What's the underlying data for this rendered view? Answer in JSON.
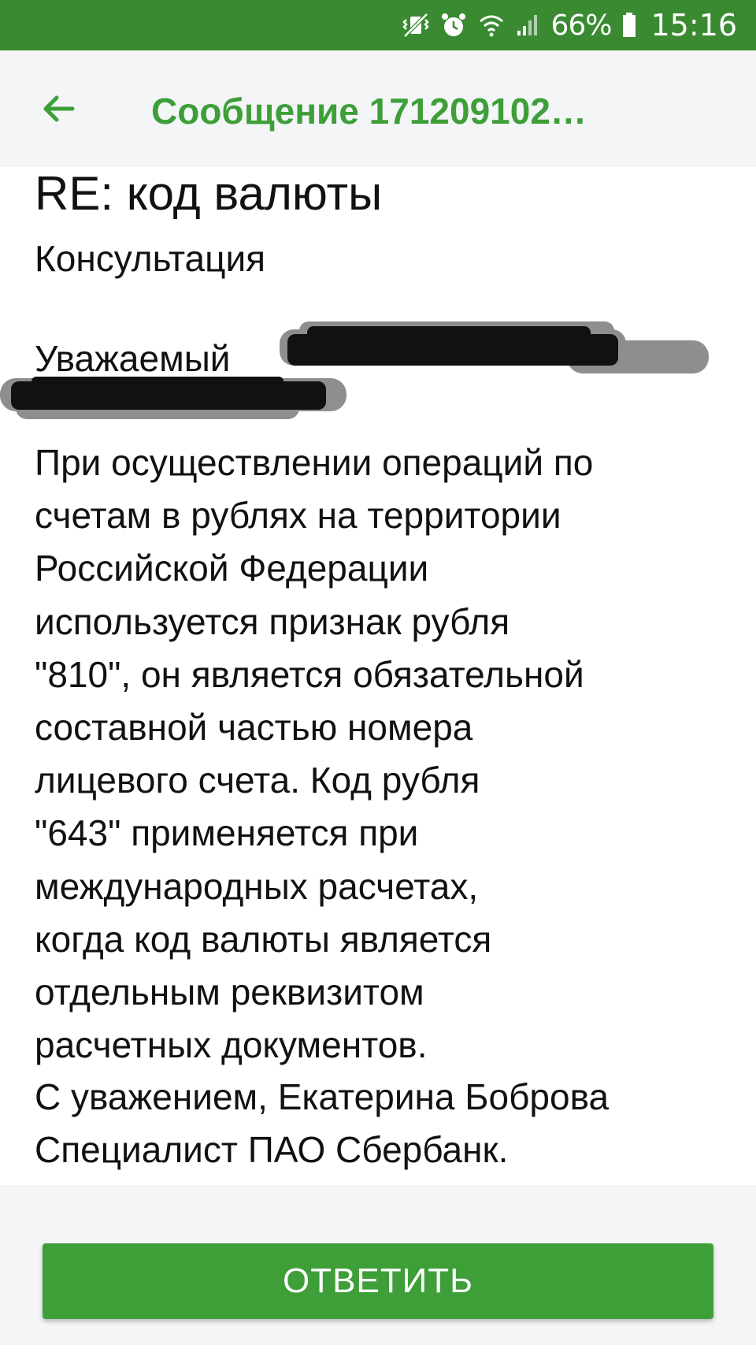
{
  "status_bar": {
    "battery": "66%",
    "time": "15:16"
  },
  "header": {
    "title": "Сообщение 171209102…"
  },
  "message": {
    "subject": "RE: код валюты",
    "category": "Консультация",
    "greeting": "Уважаемый",
    "body_lines": [
      "При осуществлении операций по",
      "счетам в рублях на территории",
      "Российской Федерации",
      "используется признак рубля",
      "\"810\", он является обязательной",
      "составной частью номера",
      "лицевого счета. Код рубля",
      "\"643\" применяется при",
      "международных расчетах,",
      "когда код валюты является",
      "отдельным реквизитом",
      "расчетных документов."
    ],
    "signature_lines": [
      "С уважением, Екатерина Боброва",
      "Специалист ПАО Сбербанк."
    ]
  },
  "reply_button": {
    "label": "ОТВЕТИТЬ"
  },
  "colors": {
    "status_bar": "#3a8a32",
    "accent": "#3e9f39",
    "app_bar_bg": "#f3f5f7"
  }
}
